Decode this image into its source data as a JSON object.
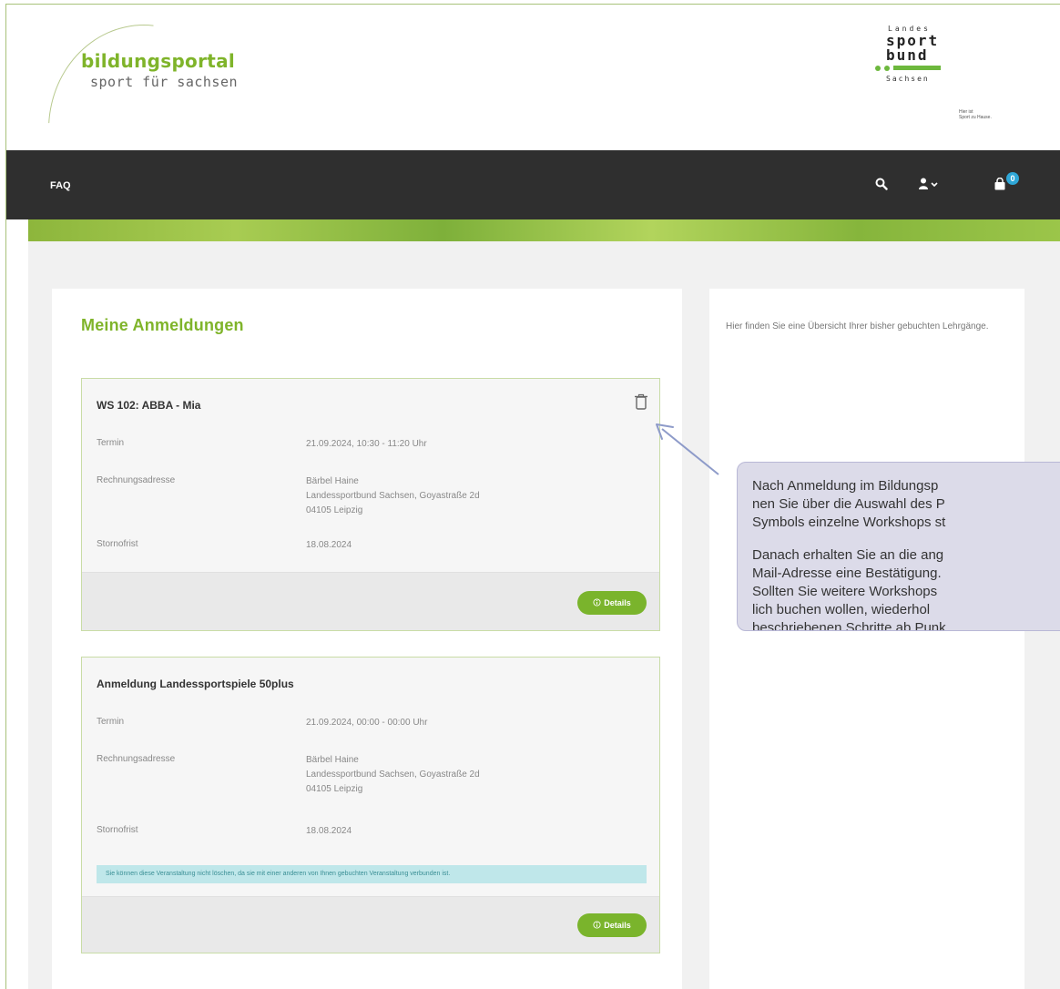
{
  "header": {
    "logo_title": "bildungsportal",
    "logo_subtitle": "sport für sachsen",
    "partner_logo": {
      "line1": "Landes",
      "line2": "sport",
      "line3": "bund",
      "line4": "Sachsen",
      "motto_1": "Hier ist",
      "motto_2": "Sport zu Hause."
    }
  },
  "nav": {
    "faq_label": "FAQ",
    "cart_count": "0",
    "icons": [
      "search-icon",
      "user-icon",
      "cart-icon"
    ]
  },
  "main": {
    "title": "Meine Anmeldungen",
    "registrations": [
      {
        "title": "WS 102: ABBA - Mia",
        "termin_label": "Termin",
        "termin_value": "21.09.2024, 10:30 - 11:20 Uhr",
        "address_label": "Rechnungsadresse",
        "address_line1": "Bärbel Haine",
        "address_line2": "Landessportbund Sachsen, Goyastraße 2d",
        "address_line3": "04105 Leipzig",
        "storno_label": "Stornofrist",
        "storno_value": "18.08.2024",
        "details_label": "Details"
      },
      {
        "title": "Anmeldung Landessportspiele 50plus",
        "termin_label": "Termin",
        "termin_value": "21.09.2024, 00:00 - 00:00 Uhr",
        "address_label": "Rechnungsadresse",
        "address_line1": "Bärbel Haine",
        "address_line2": "Landessportbund Sachsen, Goyastraße 2d",
        "address_line3": "04105 Leipzig",
        "storno_label": "Stornofrist",
        "storno_value": "18.08.2024",
        "warning": "Sie können diese Veranstaltung nicht löschen, da sie mit einer anderen von Ihnen gebuchten Veranstaltung verbunden ist.",
        "details_label": "Details"
      }
    ]
  },
  "sidebar": {
    "text": "Hier finden Sie eine Übersicht Ihrer bisher gebuchten Lehrgänge."
  },
  "callout": {
    "lines": [
      "Nach Anmeldung im Bildungsp",
      "nen Sie über die Auswahl des P",
      "Symbols einzelne Workshops st",
      "",
      "Danach erhalten Sie an die ang",
      "Mail-Adresse eine Bestätigung.",
      "Sollten Sie weitere Workshops",
      "lich buchen wollen, wiederhol",
      "beschriebenen Schritte ab Punk"
    ]
  },
  "colors": {
    "brand_green": "#7fb42a",
    "nav_bg": "#2f2f2f",
    "badge_blue": "#2fa7d7",
    "callout_bg": "#dcdbe9",
    "warning_bg": "#bfe7ea"
  }
}
